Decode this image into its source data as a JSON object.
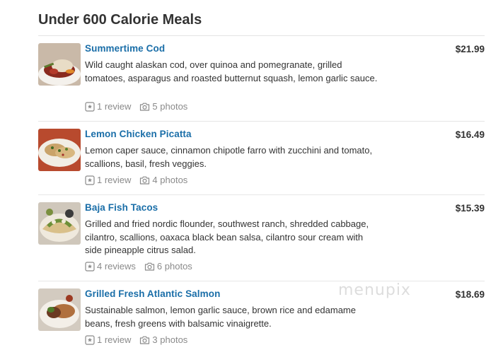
{
  "section": {
    "title": "Under 600 Calorie Meals"
  },
  "items": [
    {
      "name": "Summertime Cod",
      "price": "$21.99",
      "description": "Wild caught alaskan cod, over quinoa and pomegranate, grilled tomatoes, asparagus and roasted butternut squash, lemon garlic sauce.",
      "reviews": "1 review",
      "photos": "5 photos"
    },
    {
      "name": "Lemon Chicken Picatta",
      "price": "$16.49",
      "description": "Lemon caper sauce, cinnamon chipotle farro with zucchini and tomato, scallions, basil, fresh veggies.",
      "reviews": "1 review",
      "photos": "4 photos"
    },
    {
      "name": "Baja Fish Tacos",
      "price": "$15.39",
      "description": "Grilled and fried nordic flounder, southwest ranch, shredded cabbage, cilantro, scallions, oaxaca black bean salsa, cilantro sour cream with side pineapple citrus salad.",
      "reviews": "4 reviews",
      "photos": "6 photos"
    },
    {
      "name": "Grilled Fresh Atlantic Salmon",
      "price": "$18.69",
      "description": "Sustainable salmon, lemon garlic sauce, brown rice and edamame beans, fresh greens with balsamic vinaigrette.",
      "reviews": "1 review",
      "photos": "3 photos"
    }
  ],
  "watermark": "menupix",
  "icons": {
    "review": "star-box-icon",
    "photo": "camera-icon"
  },
  "colors": {
    "link": "#1a6ea8",
    "meta": "#8a8a8a",
    "text": "#333333",
    "divider": "#e6e6e6"
  }
}
